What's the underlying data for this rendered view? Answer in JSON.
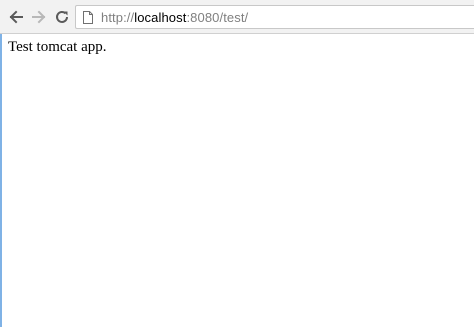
{
  "browser": {
    "url": {
      "scheme": "http://",
      "host": "localhost",
      "path": ":8080/test/"
    },
    "icons": {
      "back": "back-arrow-icon",
      "forward": "forward-arrow-icon",
      "reload": "reload-icon",
      "page": "page-icon"
    },
    "colors": {
      "toolbar_bg": "#f2f2f2",
      "forward_disabled": "#b8b8b8"
    }
  },
  "page": {
    "body_text": "Test tomcat app."
  }
}
